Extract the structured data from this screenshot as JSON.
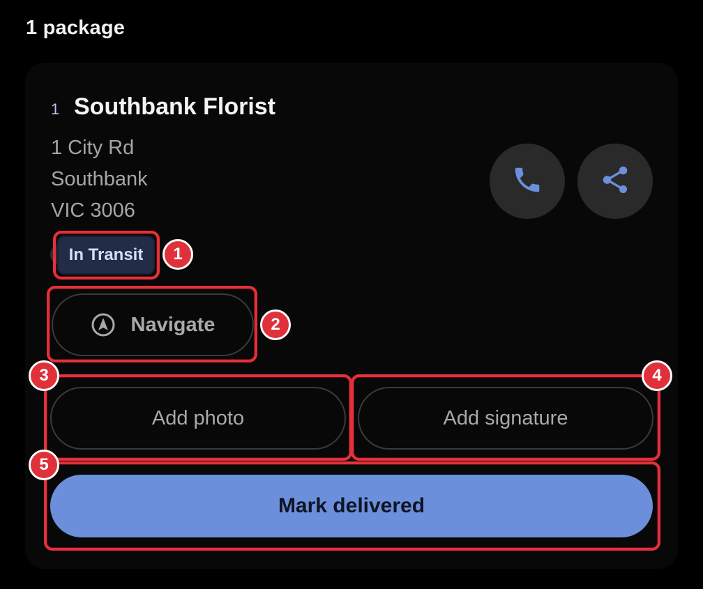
{
  "header": {
    "package_count": "1 package"
  },
  "stop": {
    "index": "1",
    "name": "Southbank Florist",
    "address_lines": [
      "1 City Rd",
      "Southbank",
      "VIC 3006"
    ],
    "status": "In Transit"
  },
  "actions": {
    "call_icon": "phone-icon",
    "share_icon": "share-icon",
    "navigate_label": "Navigate",
    "navigate_icon": "navigation-arrow-icon",
    "add_photo_label": "Add photo",
    "add_signature_label": "Add signature",
    "mark_delivered_label": "Mark delivered"
  },
  "annotations": {
    "labels": [
      "1",
      "2",
      "3",
      "4",
      "5"
    ]
  },
  "colors": {
    "accent": "#6b8fdb",
    "icon_blue": "#6b8fdb",
    "status_chip_bg": "#222c47",
    "annotation_red": "#e2313a"
  }
}
